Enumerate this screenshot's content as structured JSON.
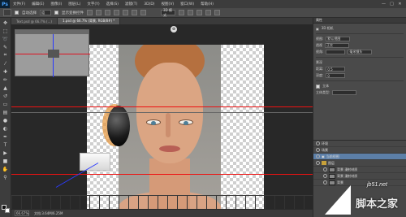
{
  "app": {
    "logo": "Ps"
  },
  "menubar": {
    "items": [
      "文件(F)",
      "编辑(E)",
      "图像(I)",
      "图层(L)",
      "文字(Y)",
      "选择(S)",
      "滤镜(T)",
      "3D(D)",
      "视图(V)",
      "窗口(W)",
      "帮助(H)"
    ],
    "controls": [
      "—",
      "□",
      "✕"
    ]
  },
  "options": {
    "auto_select_label": "自动选择",
    "auto_select_value": "组",
    "show_transform_label": "显示变换控件",
    "mode_label": "3D 模式"
  },
  "doc_tabs": [
    {
      "label": "Text.psd @ 66.7% (...)"
    },
    {
      "label": "1.psd @ 66.7% (背景, RGB/8#) *",
      "active": true
    }
  ],
  "canvas": {
    "center_button": "⊕"
  },
  "status": {
    "zoom": "66.67%",
    "doc_info": "文档:3.64M/6.25M"
  },
  "properties": {
    "title": "属性",
    "section": "3D 相机",
    "fields": [
      {
        "label": "视图:",
        "value": "默认视图"
      },
      {
        "label": "透视",
        "value": "正交"
      },
      {
        "label": "视角:",
        "value": "毫米镜头"
      },
      {
        "label": "景深",
        "value": ""
      },
      {
        "label": "距离:",
        "value": "0.5"
      },
      {
        "label": "深度:",
        "value": "0"
      }
    ],
    "stereo_label": "立体",
    "stereo_type": "立体类型:"
  },
  "layers": {
    "rows": [
      {
        "label": "环境",
        "kind": "env"
      },
      {
        "label": "场景",
        "kind": "scene"
      },
      {
        "label": "当前视图",
        "kind": "view",
        "selected": true
      },
      {
        "label": "图层",
        "kind": "folder"
      },
      {
        "label": "背景 漫射材质",
        "kind": "layer"
      },
      {
        "label": "背景 漫射材质",
        "kind": "layer"
      },
      {
        "label": "背景",
        "kind": "layer"
      }
    ]
  },
  "watermark": {
    "site": "jb51.net",
    "name": "脚本之家"
  },
  "icons": [
    "move-tool-icon",
    "marquee-icon",
    "lasso-icon",
    "crop-icon",
    "eyedropper-icon",
    "brush-icon",
    "stamp-icon",
    "eraser-icon",
    "gradient-icon",
    "pen-icon",
    "text-icon",
    "path-select-icon",
    "hand-icon",
    "zoom-icon"
  ]
}
